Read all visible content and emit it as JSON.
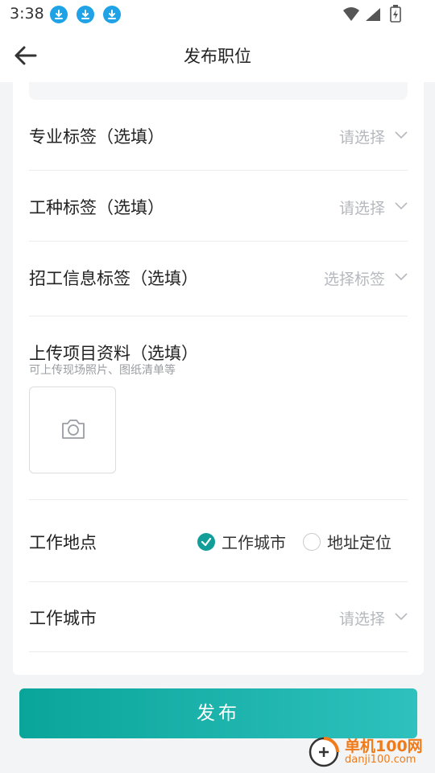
{
  "status_bar": {
    "time": "3:38",
    "download_icons": 3
  },
  "header": {
    "title": "发布职位"
  },
  "form": {
    "major_tag": {
      "label": "专业标签（选填）",
      "placeholder": "请选择"
    },
    "work_type_tag": {
      "label": "工种标签（选填）",
      "placeholder": "请选择"
    },
    "recruit_tag": {
      "label": "招工信息标签（选填）",
      "placeholder": "选择标签"
    },
    "upload": {
      "title": "上传项目资料（选填）",
      "hint": "可上传现场照片、图纸清单等"
    },
    "work_location": {
      "label": "工作地点",
      "options": [
        {
          "label": "工作城市",
          "selected": true
        },
        {
          "label": "地址定位",
          "selected": false
        }
      ]
    },
    "work_city": {
      "label": "工作城市",
      "placeholder": "请选择"
    }
  },
  "publish_button": {
    "label": "发布"
  },
  "watermark": {
    "title": "单机100网",
    "url": "danji100.com"
  },
  "colors": {
    "accent": "#129e98",
    "button_start": "#0aa59a",
    "button_end": "#2ec1bd",
    "download_icon": "#1fa2e6"
  }
}
